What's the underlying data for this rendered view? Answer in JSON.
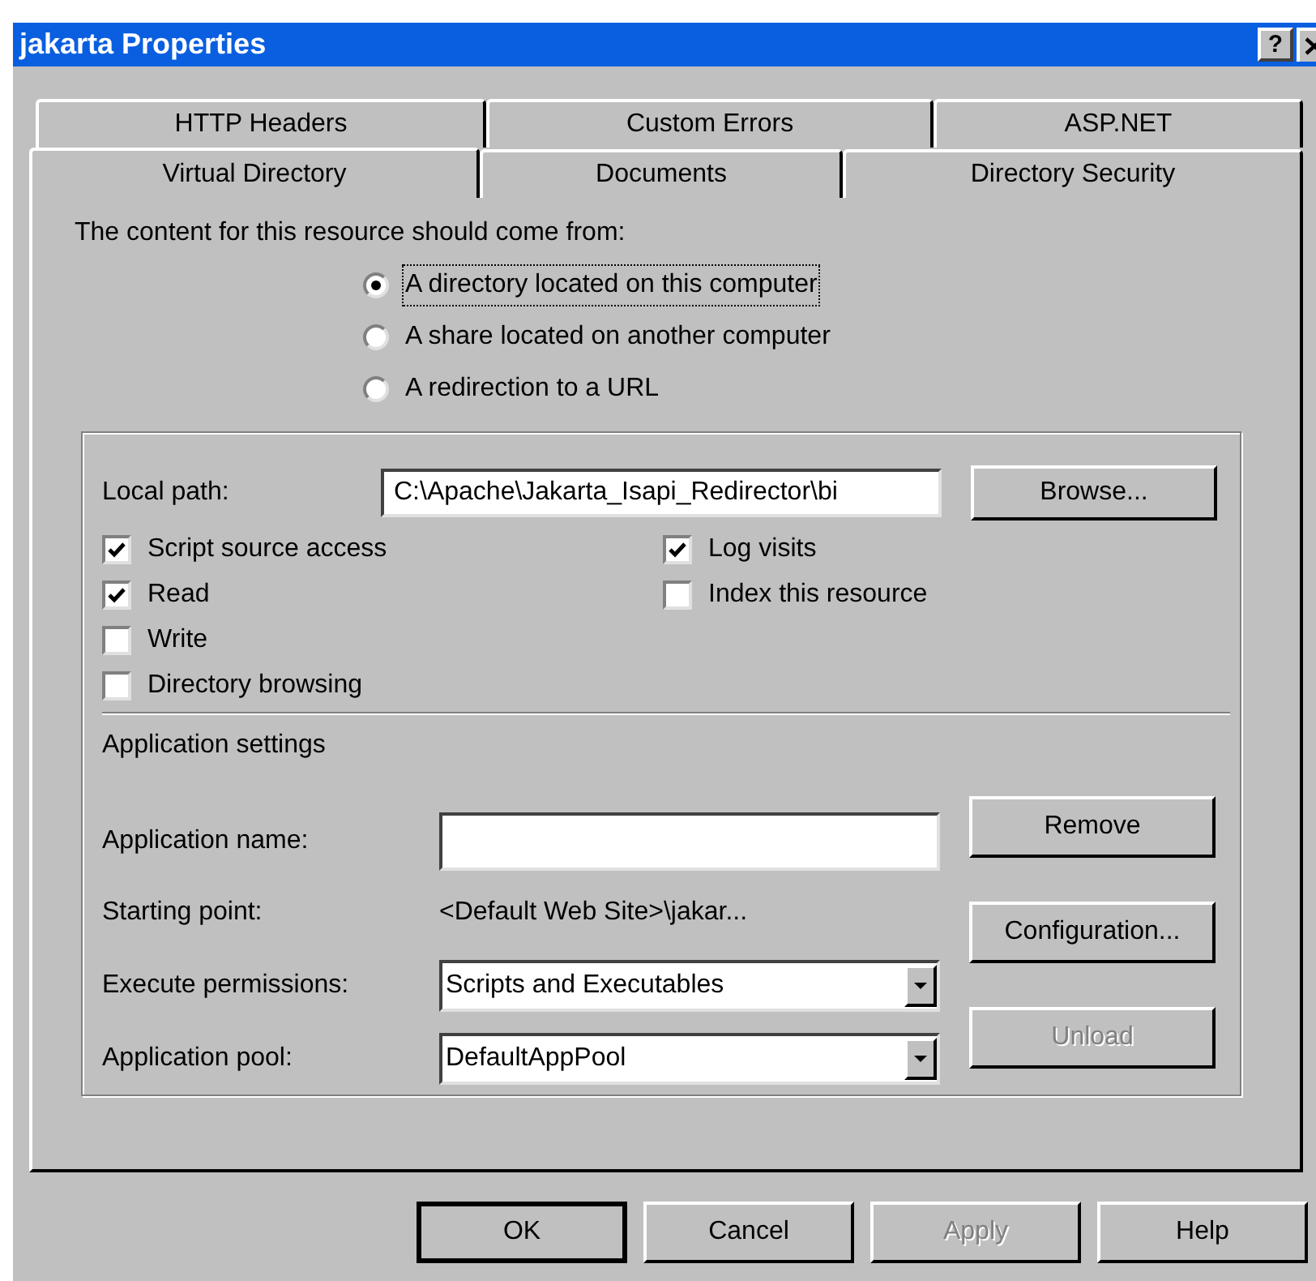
{
  "window": {
    "title": "jakarta Properties",
    "help_button": "?"
  },
  "tabs_back": [
    {
      "label": "HTTP Headers",
      "selected": false
    },
    {
      "label": "Custom Errors",
      "selected": false
    },
    {
      "label": "ASP.NET",
      "selected": false
    }
  ],
  "tabs_front": [
    {
      "label": "Virtual Directory",
      "selected": true
    },
    {
      "label": "Documents",
      "selected": false
    },
    {
      "label": "Directory Security",
      "selected": false
    }
  ],
  "source_prompt": "The content for this resource should come from:",
  "source_options": [
    {
      "label": "A directory located on this computer",
      "selected": true
    },
    {
      "label": "A share located on another computer",
      "selected": false
    },
    {
      "label": "A redirection to a URL",
      "selected": false
    }
  ],
  "local_path": {
    "label": "Local path:",
    "value": "C:\\Apache\\Jakarta_Isapi_Redirector\\bi",
    "button": "Browse..."
  },
  "permissions_left": [
    {
      "label": "Script source access",
      "checked": true
    },
    {
      "label": "Read",
      "checked": true
    },
    {
      "label": "Write",
      "checked": false
    },
    {
      "label": "Directory browsing",
      "checked": false
    }
  ],
  "permissions_right": [
    {
      "label": "Log visits",
      "checked": true
    },
    {
      "label": "Index this resource",
      "checked": false
    }
  ],
  "application_settings": {
    "heading": "Application settings",
    "rows": [
      {
        "kind": "input",
        "label": "Application name:",
        "value": ""
      },
      {
        "kind": "text",
        "label": "Starting point:",
        "value": "<Default Web Site>\\jakar..."
      },
      {
        "kind": "select",
        "label": "Execute permissions:",
        "value": "Scripts and Executables"
      },
      {
        "kind": "select",
        "label": "Application pool:",
        "value": "DefaultAppPool"
      }
    ],
    "buttons": [
      {
        "label": "Remove",
        "disabled": false
      },
      {
        "label": "Configuration...",
        "disabled": false
      },
      {
        "label": "Unload",
        "disabled": true
      }
    ]
  },
  "buttons": [
    {
      "label": "OK",
      "default": true,
      "disabled": false
    },
    {
      "label": "Cancel",
      "default": false,
      "disabled": false
    },
    {
      "label": "Apply",
      "default": false,
      "disabled": true
    },
    {
      "label": "Help",
      "default": false,
      "disabled": false
    }
  ]
}
